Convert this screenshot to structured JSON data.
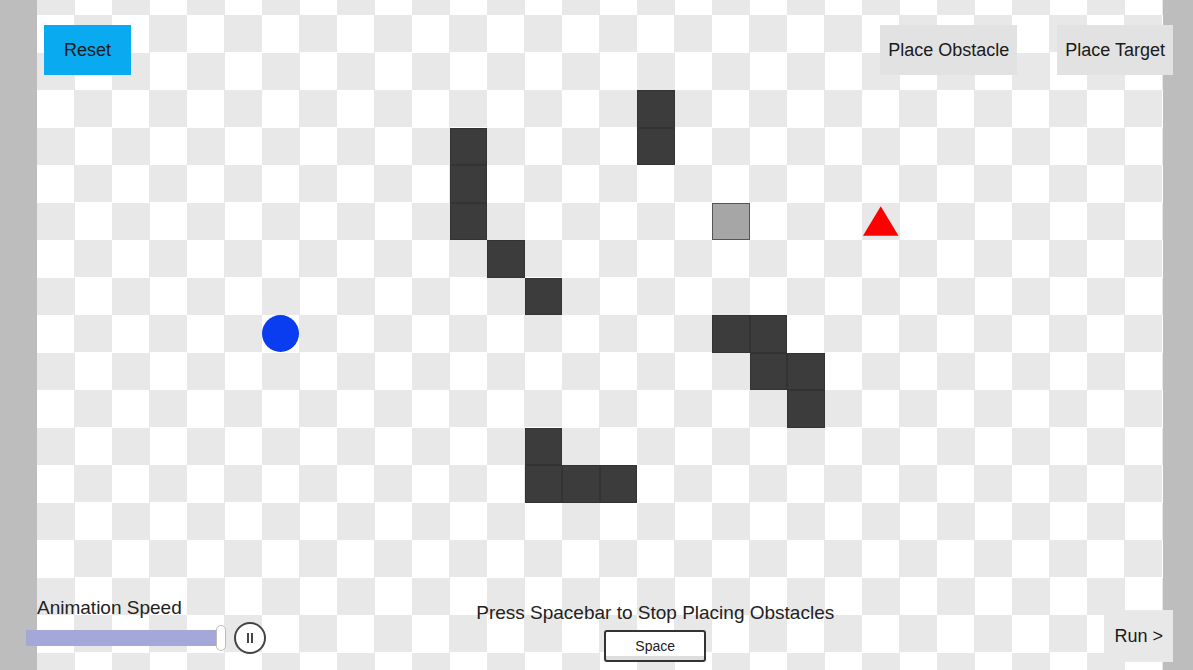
{
  "toolbar": {
    "reset": "Reset",
    "place_obstacle": "Place Obstacle",
    "place_target": "Place Target"
  },
  "grid": {
    "start": {
      "col": 6,
      "row": 8
    },
    "target": {
      "col": 22,
      "row": 5
    },
    "hover_cell": {
      "col": 18,
      "row": 5
    },
    "obstacles": [
      {
        "col": 11,
        "row": 3
      },
      {
        "col": 11,
        "row": 4
      },
      {
        "col": 11,
        "row": 5
      },
      {
        "col": 12,
        "row": 6
      },
      {
        "col": 13,
        "row": 7
      },
      {
        "col": 16,
        "row": 2
      },
      {
        "col": 16,
        "row": 3
      },
      {
        "col": 18,
        "row": 8
      },
      {
        "col": 19,
        "row": 8
      },
      {
        "col": 19,
        "row": 9
      },
      {
        "col": 20,
        "row": 9
      },
      {
        "col": 20,
        "row": 10
      },
      {
        "col": 13,
        "row": 11
      },
      {
        "col": 13,
        "row": 12
      },
      {
        "col": 14,
        "row": 12
      },
      {
        "col": 15,
        "row": 12
      }
    ]
  },
  "animation_speed": {
    "label": "Animation Speed",
    "level": 1.0,
    "paused": false
  },
  "instruction": {
    "text": "Press Spacebar to Stop Placing Obstacles",
    "key": "Space"
  },
  "run_button": "Run >"
}
